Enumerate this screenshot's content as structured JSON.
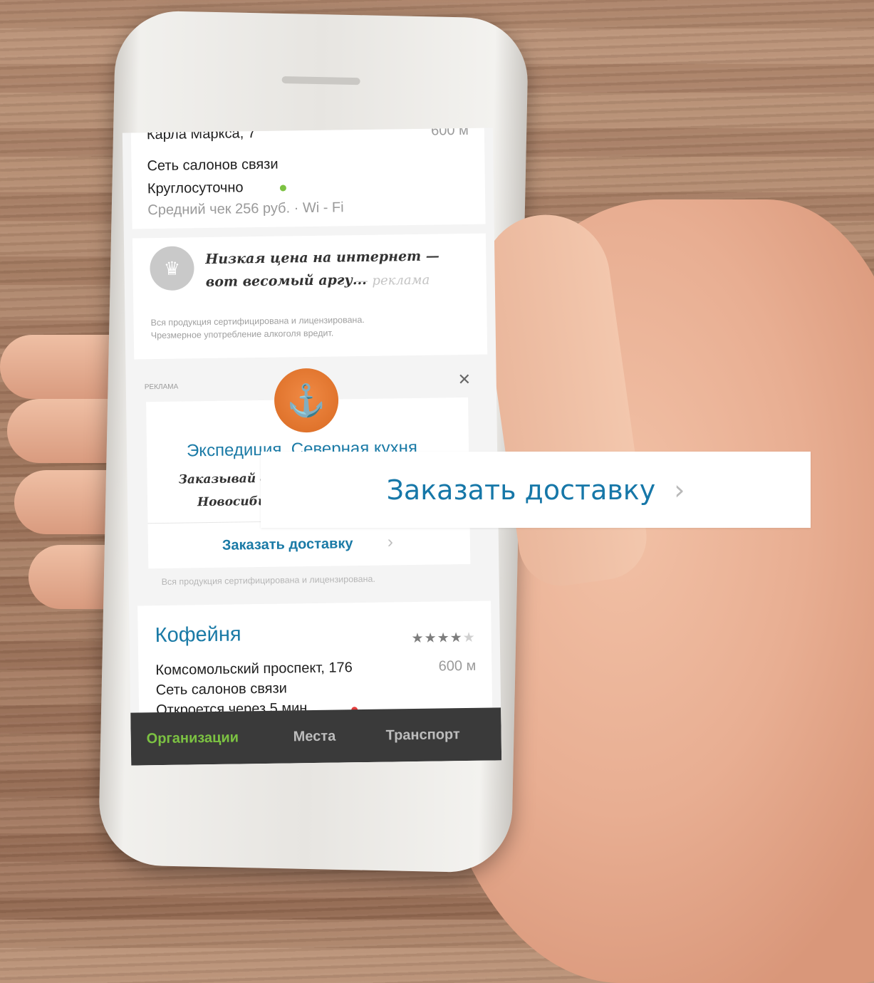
{
  "listing_top": {
    "address": "Карла Маркса, 7",
    "distance": "600 м",
    "category": "Сеть салонов связи",
    "hours": "Круглосуточно",
    "details": "Средний чек 256 руб. · Wi - Fi"
  },
  "promo": {
    "text_line1": "Низкая цена на интернет —",
    "text_line2": "вот весомый аргу...",
    "suffix": "— реклама",
    "disclaimer_line1": "Вся продукция сертифицирована и лицензирована.",
    "disclaimer_line2": "Чрезмерное употребление алкоголя вредит."
  },
  "ad": {
    "label": "РЕКЛАМА",
    "title": "Экспедиция. Северная кухня",
    "desc_line1": "Заказывай с",
    "desc_line2": "Новосибирск",
    "cta": "Заказать доставку",
    "cta_chevron": "›",
    "disclaimer": "Вся продукция сертифицирована и лицензирована."
  },
  "listing_bottom": {
    "name": "Кофейня",
    "rating": 4,
    "rating_max": 5,
    "address": "Комсомольский проспект, 176",
    "distance": "600 м",
    "category": "Сеть салонов связи",
    "hours": "Откроется через 5 мин."
  },
  "tabs": [
    {
      "label": "Организации"
    },
    {
      "label": "Места"
    },
    {
      "label": "Транспорт"
    }
  ],
  "overlay": {
    "cta": "Заказать доставку",
    "chevron": "›"
  },
  "colors": {
    "accent_blue": "#1677a8",
    "tab_active": "#7cc242",
    "status_open": "#7cc242",
    "status_closed": "#e33b3b"
  }
}
